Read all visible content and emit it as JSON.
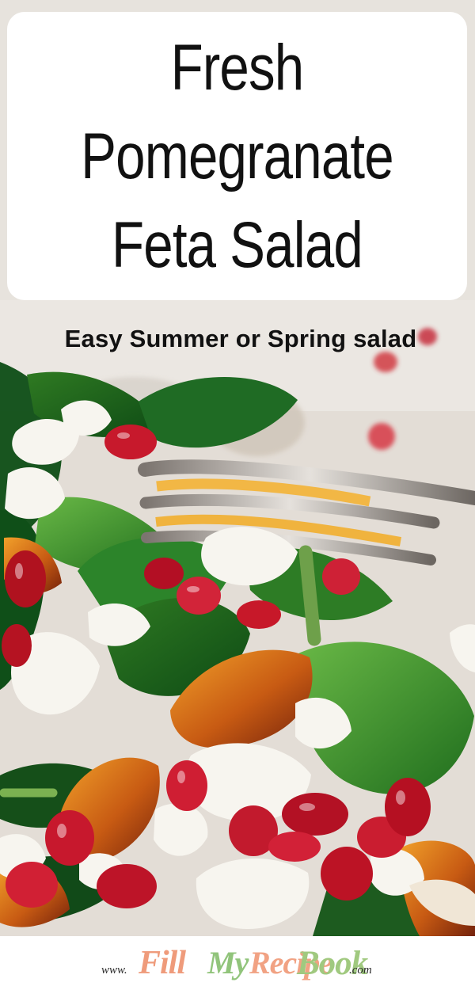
{
  "header": {
    "title_line_1": "Fresh",
    "title_line_2": "Pomegranate",
    "title_line_3": "Feta Salad"
  },
  "subtitle": "Easy Summer or Spring salad",
  "footer": {
    "www": "www.",
    "word_fill": "Fill",
    "word_my": "My",
    "word_recipe": "Recipe",
    "word_book": "Book",
    "domain": ".com"
  },
  "colors": {
    "background": "#e7e3dd",
    "title_card": "#ffffff",
    "title_text": "#111111",
    "accent_orange": "#ef9b7b",
    "accent_green": "#91c47b"
  }
}
